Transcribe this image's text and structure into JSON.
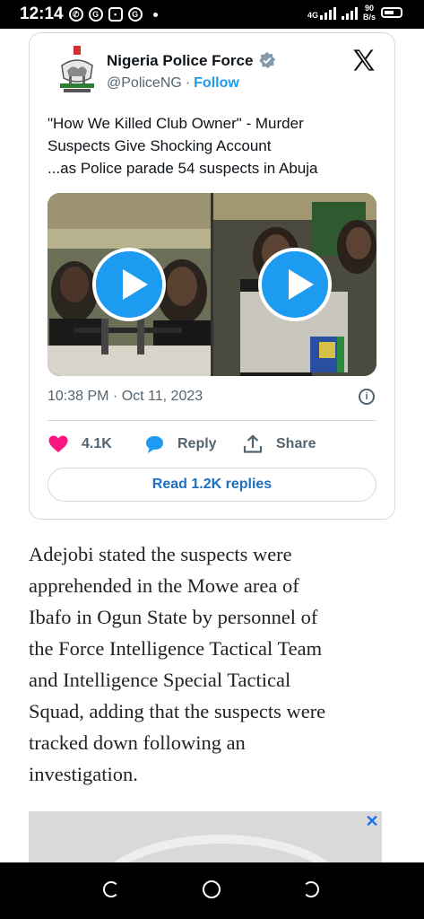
{
  "status_bar": {
    "time": "12:14",
    "network_type": "4G",
    "net_speed_value": "90",
    "net_speed_unit": "B/s",
    "icons": [
      "whatsapp-icon",
      "sync-icon",
      "game-icon",
      "sync-icon"
    ]
  },
  "tweet": {
    "author_name": "Nigeria Police Force",
    "handle": "@PoliceNG",
    "separator": "·",
    "follow_label": "Follow",
    "text_lines": [
      "\"How We Killed Club Owner\" - Murder",
      "Suspects Give Shocking Account",
      "...as Police parade 54 suspects in Abuja"
    ],
    "timestamp": "10:38 PM · Oct 11, 2023",
    "likes": "4.1K",
    "reply_label": "Reply",
    "share_label": "Share",
    "read_replies_label": "Read 1.2K replies",
    "colors": {
      "accent": "#1d9bf0",
      "like": "#f91880",
      "text_secondary": "#536471"
    }
  },
  "article": {
    "lines": [
      "Adejobi stated the suspects were",
      "apprehended in the Mowe area of",
      "Ibafo in Ogun State by personnel of",
      "the Force Intelligence Tactical Team",
      "and Intelligence Special Tactical",
      "Squad, adding that the suspects were",
      "tracked down following an",
      "investigation."
    ]
  },
  "ad": {
    "close_glyph": "✕"
  },
  "nav": {
    "icons": [
      "back-icon",
      "home-icon",
      "recents-icon"
    ]
  }
}
